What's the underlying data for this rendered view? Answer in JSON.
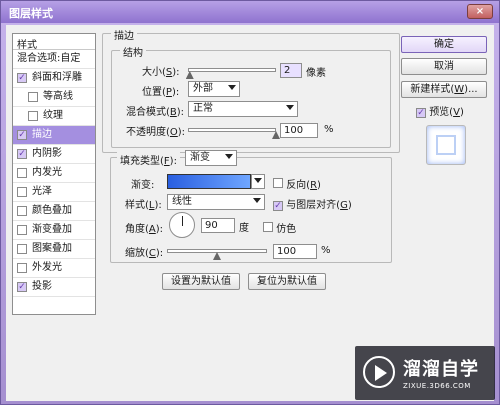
{
  "window": {
    "title": "图层样式",
    "close": "×"
  },
  "styles_panel": {
    "header": "样式",
    "items": [
      {
        "label": "混合选项:自定",
        "check": null
      },
      {
        "label": "斜面和浮雕",
        "check": true
      },
      {
        "label": "等高线",
        "check": false,
        "indent": true
      },
      {
        "label": "纹理",
        "check": false,
        "indent": true
      },
      {
        "label": "描边",
        "check": true,
        "selected": true
      },
      {
        "label": "内阴影",
        "check": true
      },
      {
        "label": "内发光",
        "check": false
      },
      {
        "label": "光泽",
        "check": false
      },
      {
        "label": "颜色叠加",
        "check": false
      },
      {
        "label": "渐变叠加",
        "check": false
      },
      {
        "label": "图案叠加",
        "check": false
      },
      {
        "label": "外发光",
        "check": false
      },
      {
        "label": "投影",
        "check": true
      }
    ]
  },
  "stroke": {
    "title": "描边",
    "structure": {
      "title": "结构",
      "size_label": "大小(",
      "size_key": "S",
      "size_tail": "):",
      "size_value": "2",
      "size_unit": "像素",
      "size_slider": 0.02,
      "position_label": "位置(",
      "position_key": "P",
      "position_tail": "):",
      "position_value": "外部",
      "blend_label": "混合模式(",
      "blend_key": "B",
      "blend_tail": "):",
      "blend_value": "正常",
      "opacity_label": "不透明度(",
      "opacity_key": "O",
      "opacity_tail": "):",
      "opacity_value": "100",
      "opacity_unit": "%",
      "opacity_slider": 1.0
    },
    "fill": {
      "type_label": "填充类型(",
      "type_key": "F",
      "type_tail": "):",
      "type_value": "渐变",
      "gradient_label": "渐变:",
      "reverse_label": "反向(",
      "reverse_key": "R",
      "reverse_tail": ")",
      "reverse_checked": false,
      "style_label": "样式(",
      "style_key": "L",
      "style_tail": "):",
      "style_value": "线性",
      "align_label": "与图层对齐(",
      "align_key": "G",
      "align_tail": ")",
      "align_checked": true,
      "angle_label": "角度(",
      "angle_key": "A",
      "angle_tail": "):",
      "angle_value": "90",
      "angle_unit": "度",
      "dither_label": "仿色",
      "dither_checked": false,
      "scale_label": "缩放(",
      "scale_key": "C",
      "scale_tail": "):",
      "scale_value": "100",
      "scale_unit": "%",
      "scale_slider": 0.5
    },
    "reset_default": "设置为默认值",
    "restore_default": "复位为默认值"
  },
  "buttons": {
    "ok": "确定",
    "cancel": "取消",
    "new_style": "新建样式(",
    "new_style_key": "W",
    "new_style_tail": ")...",
    "preview_label": "预览(",
    "preview_key": "V",
    "preview_tail": ")",
    "preview_checked": true
  },
  "watermark": {
    "title": "溜溜自学",
    "sub": "ZIXUE.3D66.COM"
  },
  "colors": {
    "accent": "#a48fe0",
    "gradient_start": "#2a5fe0",
    "gradient_end": "#6fa6ff"
  },
  "icons": {
    "check": "✓"
  }
}
